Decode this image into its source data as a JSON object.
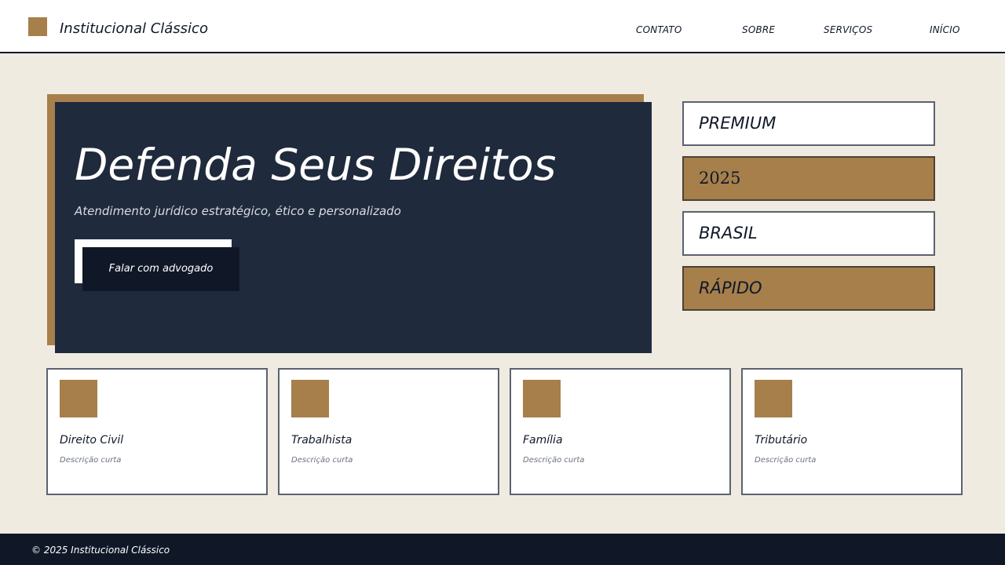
{
  "header": {
    "brand": "Institucional Clássico",
    "nav": [
      "CONTATO",
      "SOBRE",
      "SERVIÇOS",
      "INÍCIO"
    ]
  },
  "hero": {
    "title": "Defenda Seus Direitos",
    "subtitle": "Atendimento jurídico estratégico, ético e personalizado",
    "cta_label": "Falar com advogado"
  },
  "badges": [
    "PREMIUM",
    "2025",
    "BRASIL",
    "RÁPIDO"
  ],
  "cards": [
    {
      "title": "Direito Civil",
      "desc": "Descrição curta"
    },
    {
      "title": "Trabalhista",
      "desc": "Descrição curta"
    },
    {
      "title": "Família",
      "desc": "Descrição curta"
    },
    {
      "title": "Tributário",
      "desc": "Descrição curta"
    }
  ],
  "footer": {
    "text": "© 2025 Institucional Clássico"
  },
  "colors": {
    "accent": "#a67f4b",
    "navy": "#1f2a3c",
    "dark": "#101828",
    "background": "#f0ebe1"
  }
}
